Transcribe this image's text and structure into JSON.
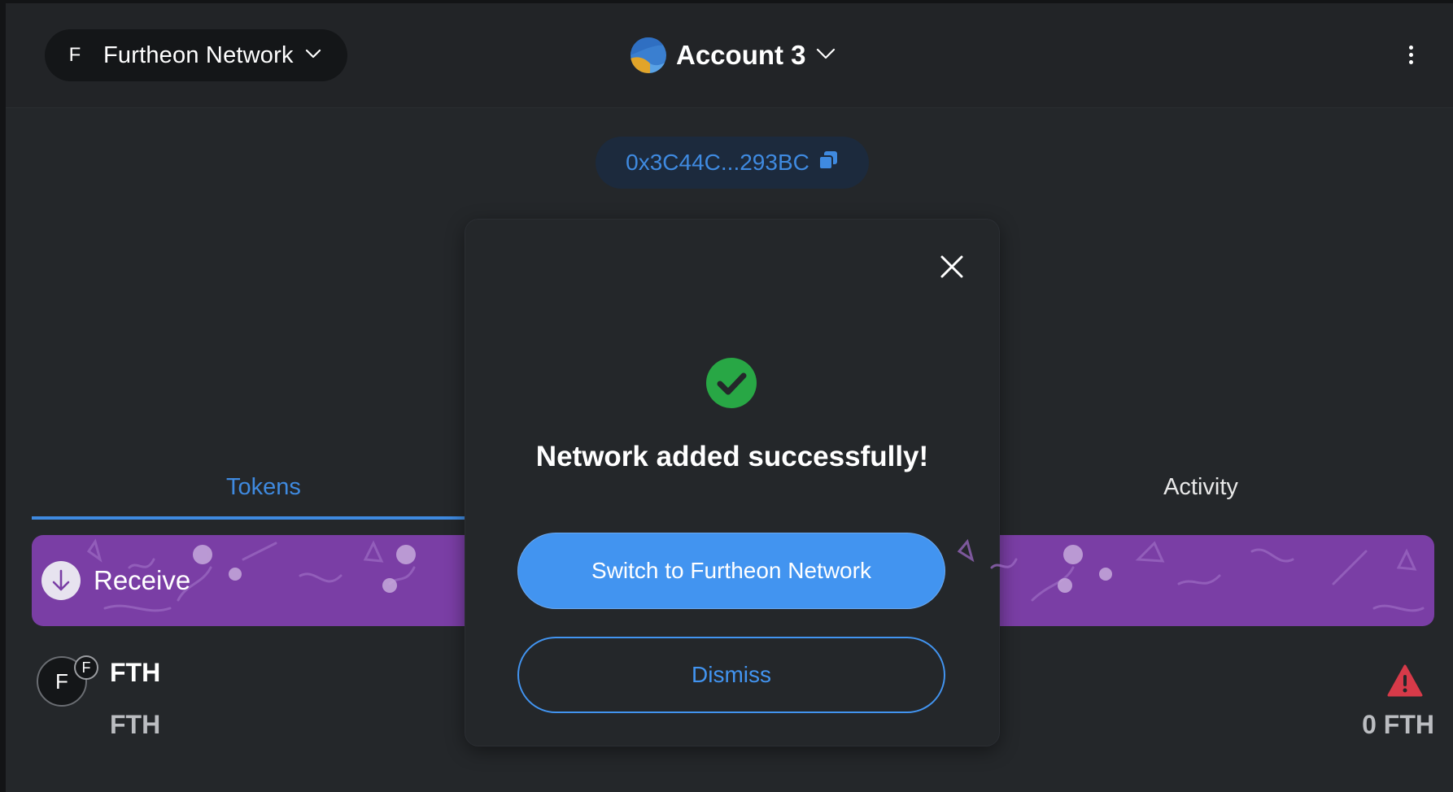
{
  "header": {
    "network": {
      "initial": "F",
      "name": "Furtheon Network"
    },
    "account": {
      "name": "Account 3"
    }
  },
  "address": {
    "short": "0x3C44C...293BC"
  },
  "tabs": [
    {
      "label": "Tokens",
      "active": true
    },
    {
      "label": "Activity",
      "active": false
    }
  ],
  "banner": {
    "label": "Receive"
  },
  "tokens": [
    {
      "icon_letter": "F",
      "badge_letter": "F",
      "symbol": "FTH",
      "subtitle": "FTH",
      "amount": "0 FTH"
    }
  ],
  "modal": {
    "title": "Network added successfully!",
    "primary_label": "Switch to Furtheon Network",
    "secondary_label": "Dismiss"
  },
  "colors": {
    "accent": "#4294f0",
    "background": "#24272a",
    "banner": "#7a3ea5",
    "success": "#28a745",
    "warning": "#d73a49"
  },
  "icons": {
    "network": "chevron-down-icon",
    "account": "chevron-down-icon",
    "menu": "kebab-menu-icon",
    "copy": "copy-icon",
    "receive": "arrow-down-icon",
    "close": "close-icon",
    "success": "check-circle-icon",
    "warning": "warning-triangle-icon"
  }
}
